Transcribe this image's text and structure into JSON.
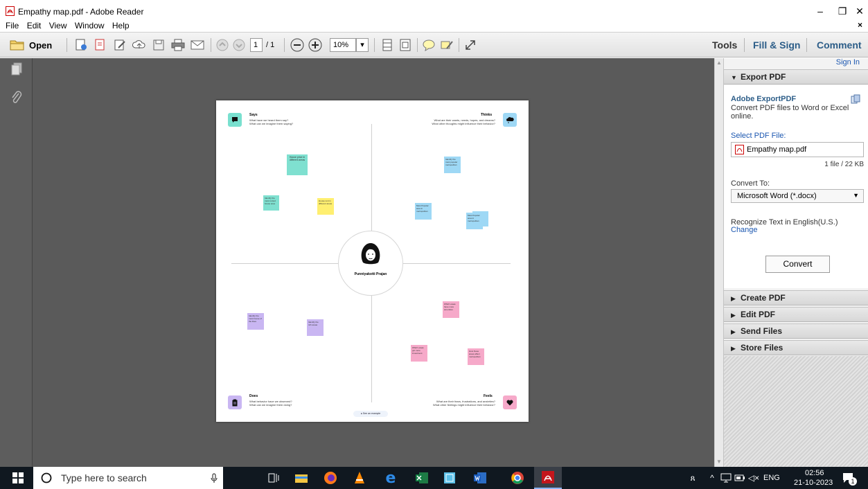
{
  "window": {
    "title": "Empathy map.pdf - Adobe Reader",
    "controls": {
      "minimize": "–",
      "maximize": "❐",
      "close": "✕"
    }
  },
  "menubar": {
    "items": [
      "File",
      "Edit",
      "View",
      "Window",
      "Help"
    ],
    "close_doc": "×"
  },
  "toolbar": {
    "open_label": "Open",
    "page_current": "1",
    "page_total": "/ 1",
    "zoom": "10%",
    "right_tabs": [
      "Tools",
      "Fill & Sign",
      "Comment"
    ]
  },
  "document": {
    "quadrants": {
      "says": {
        "title": "Says",
        "sub1": "What have we heard them say?",
        "sub2": "What can we imagine them saying?"
      },
      "thinks": {
        "title": "Thinks",
        "sub1": "What are their wants, needs, hopes, and dreams?",
        "sub2": "What other thoughts might influence their behavior?"
      },
      "does": {
        "title": "Does",
        "sub1": "What behavior have we observed?",
        "sub2": "What can we imagine them doing?"
      },
      "feels": {
        "title": "Feels",
        "sub1": "What are their fears, frustrations, and anxieties?",
        "sub2": "What other feelings might influence their behavior?"
      }
    },
    "persona_name": "Punniyakotti Prajan",
    "see_example": "See an example",
    "notes": {
      "n1": "House price in different areas",
      "n2": "Identify the most rented house area",
      "n3": "House rent in different areas",
      "n4": "Identify the most popular metropolitan",
      "n5": "Most Popular area in metropolitan",
      "n6": "Most Popular area in metropolitan",
      "n7": "Identify the most house of the likes",
      "n8": "Identify the rich areas",
      "n9": "Which areas have more amenities",
      "n10": "Which areas got more investment",
      "n11": "How these areas affect metropolitan"
    }
  },
  "right_panel": {
    "sign_in": "Sign In",
    "export_pdf": {
      "header": "Export PDF",
      "service_title": "Adobe ExportPDF",
      "service_desc": "Convert PDF files to Word or Excel online.",
      "select_label": "Select PDF File:",
      "file_name": "Empathy map.pdf",
      "file_info": "1 file / 22 KB",
      "convert_to_label": "Convert To:",
      "convert_to_value": "Microsoft Word (*.docx)",
      "recognize_text": "Recognize Text in English(U.S.)",
      "change_link": "Change",
      "convert_button": "Convert"
    },
    "sections": [
      "Create PDF",
      "Edit PDF",
      "Send Files",
      "Store Files"
    ]
  },
  "taskbar": {
    "search_placeholder": "Type here to search",
    "lang": "ENG",
    "time": "02:56",
    "date": "21-10-2023",
    "notification_count": "1"
  },
  "colors": {
    "accent_blue": "#2c5d88",
    "link_blue": "#1a56b0",
    "note_teal": "#7fe0d0",
    "note_yellow": "#ffef70",
    "note_blue": "#9ed8f5",
    "note_purple": "#c9b6f2",
    "note_pink": "#f6a9c9"
  }
}
